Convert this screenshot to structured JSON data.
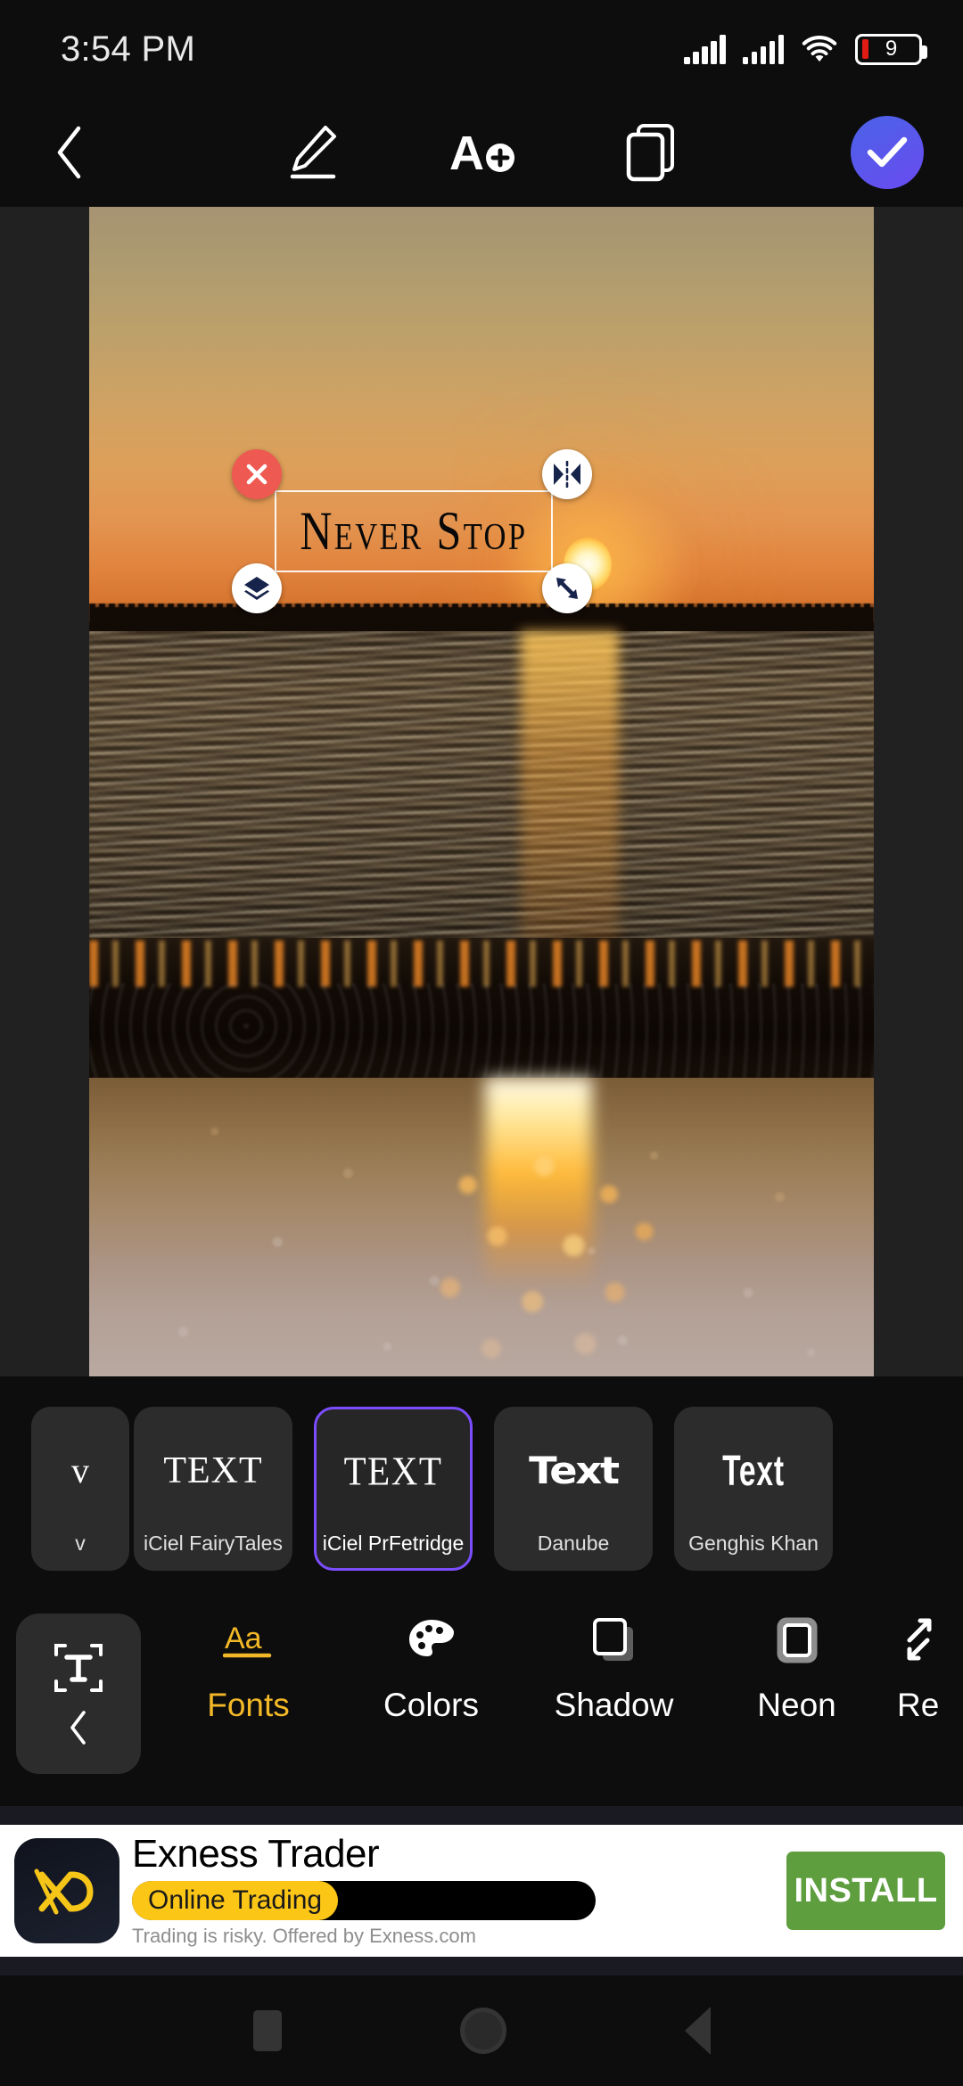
{
  "status_bar": {
    "clock": "3:54 PM",
    "battery_percent": "9",
    "icons": [
      "signal-icon",
      "signal-icon",
      "wifi-icon",
      "battery-icon"
    ]
  },
  "toolbar": {
    "back_icon": "chevron-left-icon",
    "draw_icon": "pencil-icon",
    "add_text_icon": "add-text-icon",
    "layers_icon": "duplicate-layer-icon",
    "done_icon": "checkmark-icon",
    "accent_color": "#5a52e8"
  },
  "canvas": {
    "background_color": "#212121",
    "photo_description": "sunset-over-ocean-beach",
    "text_overlay": {
      "value": "Never Stop",
      "color": "#080808",
      "selected": true
    },
    "handles": [
      {
        "name": "delete-handle",
        "icon": "close-icon",
        "color": "#ee5a52"
      },
      {
        "name": "flip-handle",
        "icon": "flip-horizontal-icon",
        "color": "#ffffff"
      },
      {
        "name": "layer-handle",
        "icon": "layers-icon",
        "color": "#ffffff"
      },
      {
        "name": "resize-handle",
        "icon": "resize-diagonal-icon",
        "color": "#ffffff"
      }
    ]
  },
  "font_carousel": {
    "scroll_up_icon": "chevron-up-icon",
    "scroll_up_color": "#4285f4",
    "selected_border_color": "#7c4dff",
    "partial_item": {
      "name": "v",
      "sample": "v"
    },
    "items": [
      {
        "name": "iCiel FairyTales",
        "sample": "TEXT",
        "selected": false
      },
      {
        "name": "iCiel PrFetridge",
        "sample": "TEXT",
        "selected": true
      },
      {
        "name": "Danube",
        "sample": "Text",
        "selected": false
      },
      {
        "name": "Genghis Khan",
        "sample": "Text",
        "selected": false
      }
    ]
  },
  "tool_row": {
    "text_panel": {
      "icon": "text-frame-icon",
      "back_icon": "chevron-left-icon"
    },
    "active_color": "#f2b827",
    "tools": [
      {
        "label": "Fonts",
        "icon": "aa-font-icon",
        "active": true
      },
      {
        "label": "Colors",
        "icon": "palette-icon",
        "active": false
      },
      {
        "label": "Shadow",
        "icon": "shadow-icon",
        "active": false
      },
      {
        "label": "Neon",
        "icon": "neon-icon",
        "active": false
      },
      {
        "label": "Re",
        "icon": "resize-arrows-icon",
        "active": false
      }
    ]
  },
  "ad": {
    "icon": "exness-logo-icon",
    "title": "Exness Trader",
    "tag": "Online Trading",
    "disclaimer": "Trading is risky. Offered by Exness.com",
    "cta": "INSTALL",
    "cta_color": "#5f9e3f",
    "tag_color": "#fcc617"
  },
  "nav_bar": {
    "recents_icon": "square-icon",
    "home_icon": "circle-icon",
    "back_icon": "triangle-back-icon"
  }
}
